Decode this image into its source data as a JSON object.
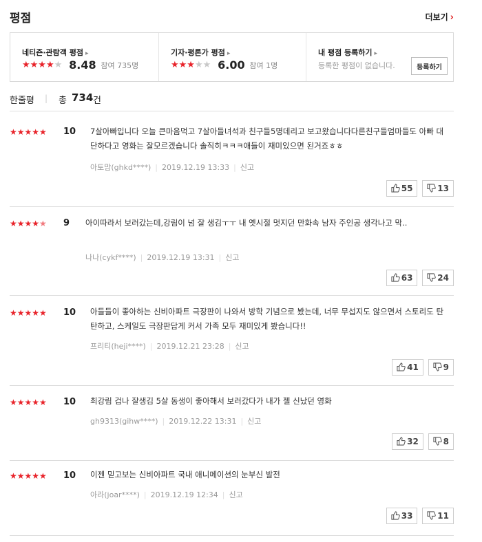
{
  "header": {
    "title": "평점",
    "more_label": "더보기",
    "more_chevron": "›"
  },
  "summary": {
    "netizen": {
      "label": "네티즌·관람객 평점",
      "stars": "★★★★★",
      "score": "8.48",
      "participation": "참여 735명"
    },
    "critic": {
      "label": "기자·평론가 평점",
      "stars": "★★★★★",
      "score": "6.00",
      "participation": "참여 1명"
    },
    "mine": {
      "label": "내 평점 등록하기",
      "note": "등록한 평점이 없습니다.",
      "button": "등록하기"
    }
  },
  "count": {
    "label": "한줄평",
    "separator": "|",
    "total_prefix": "총",
    "total": "734",
    "unit": "건"
  },
  "colors": {
    "star": "#e8232a",
    "star_off": "#c8c8c8"
  },
  "reviews": [
    {
      "score": "10",
      "stars": "★★★★★",
      "text": "7살아빠입니다 오늘 큰마음먹고 7살아들녀석과 친구들5명데리고 보고왔습니다다른친구들엄마들도 아빠 대단하다고 영화는 잘모르겠습니다 솔직히ㅋㅋㅋ애들이 재미있으면 된거죠ㅎㅎ",
      "author": "아토맘(ghkd****)",
      "date": "2019.12.19 13:33",
      "report": "신고",
      "like": "55",
      "dislike": "13"
    },
    {
      "score": "9",
      "stars": "★★★★",
      "half_star": "★",
      "text": "아이따라서 보러갔는데,강림이 넘 잘 생김ㅜㅜ 내 옛시절 멋지던 만화속 남자 주인공 생각나고 막..",
      "author": "나나(cykf****)",
      "date": "2019.12.19 13:31",
      "report": "신고",
      "like": "63",
      "dislike": "24"
    },
    {
      "score": "10",
      "stars": "★★★★★",
      "text": "아들들이 좋아하는 신비아파트 극장판이 나와서 방학 기념으로 봤는데, 너무 무섭지도 않으면서 스토리도 탄탄하고, 스케일도 극장판답게 커서 가족 모두 재미있게 봤습니다!!",
      "author": "프리티(heji****)",
      "date": "2019.12.21 23:28",
      "report": "신고",
      "like": "41",
      "dislike": "9"
    },
    {
      "score": "10",
      "stars": "★★★★★",
      "text": "최강림 겁나 잘생김 5살 동생이 좋아해서 보러갔다가 내가 젤 신났던 영화",
      "author": "gh9313(gihw****)",
      "date": "2019.12.22 13:31",
      "report": "신고",
      "like": "32",
      "dislike": "8"
    },
    {
      "score": "10",
      "stars": "★★★★★",
      "text": "이젠 믿고보는 신비아파트 국내 애니메이션의 눈부신 발전",
      "author": "아라(joar****)",
      "date": "2019.12.19 12:34",
      "report": "신고",
      "like": "33",
      "dislike": "11"
    }
  ]
}
